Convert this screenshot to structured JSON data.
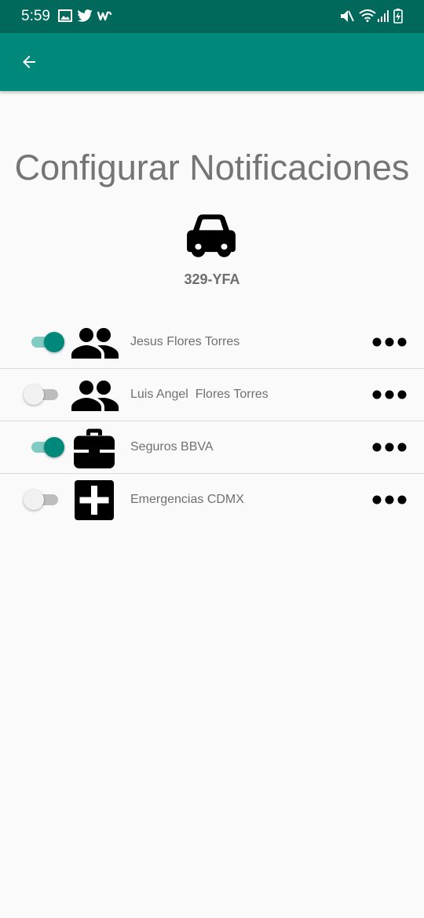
{
  "status_bar": {
    "time": "5:59",
    "left_icons": [
      "image-icon",
      "twitter-icon",
      "w-app-icon"
    ],
    "right_icons": [
      "vibrate-mute-icon",
      "wifi-icon",
      "signal-icon",
      "battery-charging-icon"
    ]
  },
  "app_bar": {
    "back_icon": "arrow-back-icon",
    "color": "#00897b"
  },
  "page": {
    "title": "Configurar Notificaciones",
    "vehicle_icon": "car-icon",
    "plate": "329-YFA"
  },
  "contacts": [
    {
      "name": "Jesus Flores Torres",
      "enabled": true,
      "icon": "people-icon"
    },
    {
      "name": "Luis Angel  Flores Torres",
      "enabled": false,
      "icon": "people-icon"
    },
    {
      "name": "Seguros BBVA",
      "enabled": true,
      "icon": "medical-kit-icon"
    },
    {
      "name": "Emergencias CDMX",
      "enabled": false,
      "icon": "first-aid-icon"
    }
  ],
  "colors": {
    "status_bar": "#00695c",
    "accent": "#00897b",
    "toggle_on_track": "#80cbc4"
  }
}
